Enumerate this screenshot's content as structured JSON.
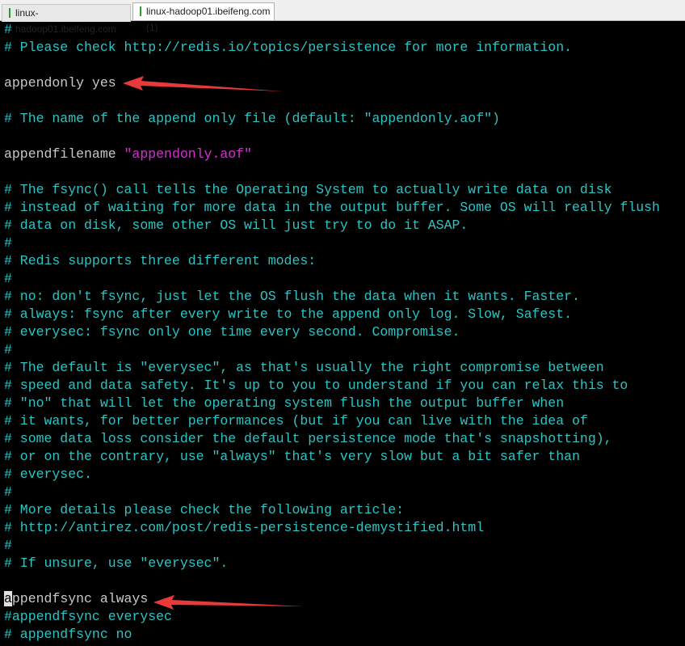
{
  "tabs": [
    {
      "label": "linux-hadoop01.ibeifeng.com"
    },
    {
      "label": "linux-hadoop01.ibeifeng.com (1)",
      "active": true
    }
  ],
  "colors": {
    "comment": "#2ec4c4",
    "text": "#c8c8c8",
    "string": "#d430d4",
    "arrow": "#e83a3a"
  },
  "lines": [
    {
      "t": "#",
      "k": "c"
    },
    {
      "t": "# Please check http://redis.io/topics/persistence for more information.",
      "k": "c"
    },
    {
      "t": "",
      "k": "w"
    },
    {
      "t": "appendonly yes",
      "k": "w"
    },
    {
      "t": "",
      "k": "w"
    },
    {
      "t": "# The name of the append only file (default: \"appendonly.aof\")",
      "k": "c"
    },
    {
      "t": "",
      "k": "w"
    },
    {
      "t": "appendfilename ",
      "k": "w",
      "str": "\"appendonly.aof\""
    },
    {
      "t": "",
      "k": "w"
    },
    {
      "t": "# The fsync() call tells the Operating System to actually write data on disk",
      "k": "c"
    },
    {
      "t": "# instead of waiting for more data in the output buffer. Some OS will really flush",
      "k": "c"
    },
    {
      "t": "# data on disk, some other OS will just try to do it ASAP.",
      "k": "c"
    },
    {
      "t": "#",
      "k": "c"
    },
    {
      "t": "# Redis supports three different modes:",
      "k": "c"
    },
    {
      "t": "#",
      "k": "c"
    },
    {
      "t": "# no: don't fsync, just let the OS flush the data when it wants. Faster.",
      "k": "c"
    },
    {
      "t": "# always: fsync after every write to the append only log. Slow, Safest.",
      "k": "c"
    },
    {
      "t": "# everysec: fsync only one time every second. Compromise.",
      "k": "c"
    },
    {
      "t": "#",
      "k": "c"
    },
    {
      "t": "# The default is \"everysec\", as that's usually the right compromise between",
      "k": "c"
    },
    {
      "t": "# speed and data safety. It's up to you to understand if you can relax this to",
      "k": "c"
    },
    {
      "t": "# \"no\" that will let the operating system flush the output buffer when",
      "k": "c"
    },
    {
      "t": "# it wants, for better performances (but if you can live with the idea of",
      "k": "c"
    },
    {
      "t": "# some data loss consider the default persistence mode that's snapshotting),",
      "k": "c"
    },
    {
      "t": "# or on the contrary, use \"always\" that's very slow but a bit safer than",
      "k": "c"
    },
    {
      "t": "# everysec.",
      "k": "c"
    },
    {
      "t": "#",
      "k": "c"
    },
    {
      "t": "# More details please check the following article:",
      "k": "c"
    },
    {
      "t": "# http://antirez.com/post/redis-persistence-demystified.html",
      "k": "c"
    },
    {
      "t": "#",
      "k": "c"
    },
    {
      "t": "# If unsure, use \"everysec\".",
      "k": "c"
    },
    {
      "t": "",
      "k": "w"
    },
    {
      "t": "ppendfsync always",
      "k": "w",
      "cursor": "a"
    },
    {
      "t": "#appendfsync everysec",
      "k": "c"
    },
    {
      "t": "# appendfsync no",
      "k": "c"
    }
  ]
}
